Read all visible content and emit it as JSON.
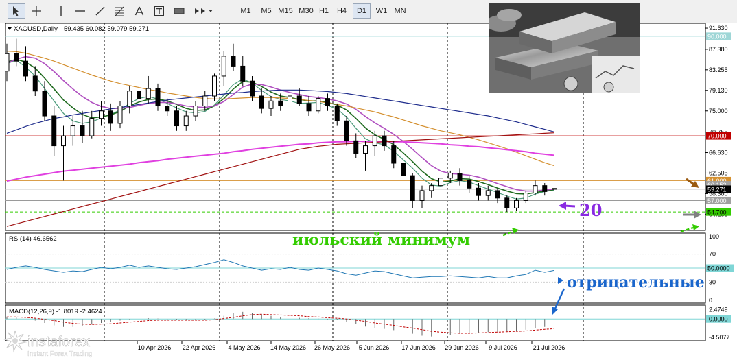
{
  "toolbar": {
    "timeframes": [
      "M1",
      "M5",
      "M15",
      "M30",
      "H1",
      "H4",
      "D1",
      "W1",
      "MN"
    ],
    "active_timeframe": "D1",
    "tools": [
      "cursor-icon",
      "crosshair-icon",
      "vertical-line-icon",
      "horizontal-line-icon",
      "trendline-icon",
      "fibonacci-icon",
      "text-icon",
      "text-label-icon",
      "rectangle-icon",
      "arrows-icon"
    ]
  },
  "main": {
    "symbol_title": "XAGUSD,Daily",
    "ohlc_text": "59.435 60.082 59.079 59.271"
  },
  "colors": {
    "bull": "#ffffff",
    "bear": "#000000",
    "ma_fast": "#4a9a7a",
    "ma_mid": "#1e6a1e",
    "ma_violet": "#b050c0",
    "ma_orange": "#d49030",
    "ma_blue": "#1e2c8c",
    "ma_magenta": "#e040e0",
    "ma_red": "#a01010",
    "rsi": "#1f77b4",
    "macd_signal": "#c00000",
    "annotation_green": "#33cc00",
    "annotation_blue": "#1a66cc",
    "annotation_violet": "#8a2be2",
    "annotation_brown": "#9a5a10",
    "annotation_gray": "#808080"
  },
  "chart_data": [
    {
      "type": "candlestick",
      "symbol": "XAGUSD",
      "timeframe": "Daily",
      "ylim": [
        51.0,
        92.6
      ],
      "y_ticks": [
        "91.630",
        "87.380",
        "83.255",
        "79.130",
        "75.000",
        "70.755",
        "66.630",
        "62.505",
        "58.380",
        "54.255"
      ],
      "x_ticks": [
        "10 Apr 2026",
        "22 Apr 2026",
        "4 May 2026",
        "14 May 2026",
        "26 May 2026",
        "5 Jun 2026",
        "17 Jun 2026",
        "29 Jun 2026",
        "9 Jul 2026",
        "21 Jul 2026"
      ],
      "price_labels": [
        {
          "text": "90.000",
          "value": 90.0
        },
        {
          "text": "70.000",
          "value": 70.0
        },
        {
          "text": "61.000",
          "value": 61.0
        },
        {
          "text": "60.152",
          "value": 60.15
        },
        {
          "text": "59.271",
          "value": 59.271
        },
        {
          "text": "57.000",
          "value": 57.0
        },
        {
          "text": "54.700",
          "value": 54.7
        }
      ],
      "horizontal_levels": [
        90.0,
        70.0,
        61.0,
        57.0,
        54.7
      ],
      "annotations": [
        {
          "text": "июльский минимум"
        },
        {
          "text": "20"
        }
      ],
      "moving_averages": [
        {
          "color": "#4a9a7a",
          "values": [
            84.5,
            85.2,
            83.8,
            82.0,
            79.5,
            77.0,
            74.5,
            73.0,
            72.5,
            72.8,
            73.6,
            74.3,
            75.2,
            76.5,
            77.5,
            77.9,
            77.4,
            76.5,
            75.6,
            74.8,
            74.6,
            74.9,
            76.2,
            78.2,
            80.3,
            81.4,
            80.6,
            79.1,
            77.9,
            77.3,
            77.0,
            76.5,
            76.6,
            76.7,
            76.1,
            75.4,
            73.8,
            71.5,
            69.4,
            68.6,
            68.2,
            66.9,
            65.2,
            63.5,
            61.5,
            60.1,
            59.9,
            60.6,
            61.0,
            60.7,
            60.0,
            59.3,
            58.6,
            57.9,
            57.3,
            57.5,
            58.3,
            58.8,
            59.1
          ]
        },
        {
          "color": "#1e6a1e",
          "values": [
            84.8,
            85.4,
            84.8,
            83.6,
            81.6,
            79.4,
            77.2,
            75.6,
            74.3,
            73.6,
            73.8,
            74.2,
            74.9,
            76.0,
            76.8,
            77.3,
            77.4,
            77.0,
            76.3,
            75.5,
            75.1,
            75.2,
            76.0,
            77.5,
            79.4,
            80.9,
            80.8,
            79.9,
            78.8,
            78.0,
            77.7,
            77.3,
            77.0,
            77.0,
            76.7,
            76.2,
            75.2,
            73.5,
            71.6,
            70.2,
            69.3,
            68.2,
            66.6,
            64.8,
            62.9,
            61.4,
            60.7,
            60.9,
            61.4,
            61.3,
            60.8,
            60.2,
            59.5,
            58.9,
            58.4,
            58.3,
            58.6,
            58.9,
            59.2
          ]
        },
        {
          "color": "#b050c0",
          "values": [
            84.6,
            85.4,
            85.9,
            85.6,
            84.5,
            82.9,
            81.1,
            79.4,
            77.9,
            76.7,
            75.9,
            75.5,
            75.5,
            75.7,
            76.1,
            76.5,
            76.7,
            76.7,
            76.4,
            76.0,
            75.8,
            75.7,
            76.0,
            76.9,
            78.3,
            79.8,
            80.4,
            80.3,
            79.8,
            79.2,
            78.7,
            78.3,
            77.9,
            77.7,
            77.4,
            77.0,
            76.4,
            75.3,
            73.9,
            72.6,
            71.5,
            70.3,
            68.9,
            67.3,
            65.6,
            64.0,
            62.9,
            62.4,
            62.3,
            62.1,
            61.7,
            61.1,
            60.4,
            59.8,
            59.2,
            58.9,
            58.9,
            59.1,
            59.3
          ]
        },
        {
          "color": "#d49030",
          "values": [
            87.0,
            86.9,
            86.6,
            86.1,
            85.6,
            85.0,
            84.3,
            83.6,
            82.9,
            82.2,
            81.6,
            81.0,
            80.5,
            80.1,
            79.7,
            79.3,
            79.0,
            78.6,
            78.3,
            78.0,
            77.7,
            77.5,
            77.4,
            77.4,
            77.5,
            77.6,
            77.7,
            77.7,
            77.7,
            77.6,
            77.5,
            77.3,
            77.1,
            76.9,
            76.6,
            76.3,
            76.0,
            75.6,
            75.2,
            74.8,
            74.3,
            73.8,
            73.2,
            72.6,
            72.0,
            71.5,
            71.0,
            70.6,
            70.2,
            69.7,
            69.2,
            68.6,
            68.0,
            67.4,
            66.7,
            66.0,
            65.3,
            64.6,
            64.0
          ]
        },
        {
          "color": "#1e2c8c",
          "values": [
            70.5,
            71.2,
            71.9,
            72.5,
            73.0,
            73.5,
            73.8,
            74.2,
            74.5,
            74.8,
            75.1,
            75.4,
            75.7,
            76.0,
            76.3,
            76.6,
            76.9,
            77.2,
            77.4,
            77.6,
            77.8,
            78.0,
            78.2,
            78.4,
            78.6,
            78.7,
            78.9,
            79.0,
            79.1,
            79.2,
            79.2,
            79.2,
            79.1,
            79.0,
            78.9,
            78.7,
            78.5,
            78.2,
            77.9,
            77.6,
            77.3,
            77.0,
            76.7,
            76.4,
            76.1,
            75.8,
            75.5,
            75.2,
            74.9,
            74.6,
            74.3,
            74.0,
            73.6,
            73.2,
            72.8,
            72.3,
            71.8,
            71.3,
            70.8
          ]
        },
        {
          "color": "#e040e0",
          "values": [
            60.9,
            61.3,
            61.7,
            62.0,
            62.3,
            62.6,
            62.9,
            63.1,
            63.3,
            63.5,
            63.7,
            63.9,
            64.1,
            64.3,
            64.6,
            64.8,
            65.0,
            65.3,
            65.5,
            65.7,
            65.9,
            66.1,
            66.3,
            66.5,
            66.8,
            67.0,
            67.3,
            67.5,
            67.7,
            67.9,
            68.1,
            68.3,
            68.4,
            68.6,
            68.7,
            68.8,
            68.8,
            68.9,
            68.9,
            68.9,
            68.9,
            68.8,
            68.8,
            68.7,
            68.6,
            68.5,
            68.4,
            68.2,
            68.1,
            67.9,
            67.8,
            67.6,
            67.4,
            67.2,
            67.0,
            66.8,
            66.5,
            66.3,
            66.1
          ]
        },
        {
          "color": "#a01010",
          "values": [
            51.8,
            52.3,
            52.8,
            53.3,
            53.8,
            54.3,
            54.8,
            55.3,
            55.8,
            56.3,
            56.8,
            57.3,
            57.8,
            58.3,
            58.8,
            59.3,
            59.8,
            60.3,
            60.8,
            61.3,
            61.8,
            62.3,
            62.8,
            63.3,
            63.8,
            64.3,
            64.8,
            65.3,
            65.8,
            66.3,
            66.8,
            67.3,
            67.6,
            67.9,
            68.1,
            68.3,
            68.4,
            68.5,
            68.6,
            68.7,
            68.8,
            68.9,
            69.0,
            69.1,
            69.2,
            69.3,
            69.4,
            69.5,
            69.6,
            69.7,
            69.8,
            69.9,
            70.0,
            70.1,
            70.2,
            70.3,
            70.4,
            70.5,
            70.6
          ]
        }
      ],
      "candles": [
        {
          "o": 83.0,
          "h": 88.5,
          "l": 81.0,
          "c": 86.5
        },
        {
          "o": 86.5,
          "h": 89.5,
          "l": 84.0,
          "c": 85.0
        },
        {
          "o": 85.0,
          "h": 88.0,
          "l": 81.0,
          "c": 82.0
        },
        {
          "o": 82.0,
          "h": 84.0,
          "l": 78.0,
          "c": 79.0
        },
        {
          "o": 79.0,
          "h": 81.0,
          "l": 73.0,
          "c": 74.0
        },
        {
          "o": 74.0,
          "h": 76.0,
          "l": 66.0,
          "c": 68.0
        },
        {
          "o": 68.0,
          "h": 72.0,
          "l": 61.0,
          "c": 70.0
        },
        {
          "o": 70.0,
          "h": 74.0,
          "l": 68.0,
          "c": 72.0
        },
        {
          "o": 72.0,
          "h": 75.0,
          "l": 68.5,
          "c": 70.0
        },
        {
          "o": 70.0,
          "h": 75.0,
          "l": 69.5,
          "c": 73.5
        },
        {
          "o": 73.5,
          "h": 77.0,
          "l": 72.0,
          "c": 75.0
        },
        {
          "o": 75.0,
          "h": 76.5,
          "l": 71.0,
          "c": 72.5
        },
        {
          "o": 72.5,
          "h": 77.0,
          "l": 71.5,
          "c": 76.0
        },
        {
          "o": 76.0,
          "h": 80.0,
          "l": 74.5,
          "c": 79.0
        },
        {
          "o": 79.0,
          "h": 81.5,
          "l": 76.5,
          "c": 77.5
        },
        {
          "o": 77.5,
          "h": 82.0,
          "l": 76.5,
          "c": 79.5
        },
        {
          "o": 79.5,
          "h": 80.5,
          "l": 75.0,
          "c": 76.0
        },
        {
          "o": 76.0,
          "h": 77.5,
          "l": 74.0,
          "c": 75.0
        },
        {
          "o": 75.0,
          "h": 76.0,
          "l": 71.0,
          "c": 72.0
        },
        {
          "o": 72.0,
          "h": 75.0,
          "l": 71.0,
          "c": 74.0
        },
        {
          "o": 74.0,
          "h": 77.0,
          "l": 73.0,
          "c": 76.0
        },
        {
          "o": 76.0,
          "h": 79.0,
          "l": 75.0,
          "c": 78.0
        },
        {
          "o": 78.0,
          "h": 82.5,
          "l": 77.0,
          "c": 82.0
        },
        {
          "o": 82.0,
          "h": 87.0,
          "l": 80.0,
          "c": 86.0
        },
        {
          "o": 86.0,
          "h": 88.5,
          "l": 83.0,
          "c": 84.0
        },
        {
          "o": 84.0,
          "h": 86.0,
          "l": 80.0,
          "c": 81.0
        },
        {
          "o": 81.0,
          "h": 82.0,
          "l": 77.0,
          "c": 78.0
        },
        {
          "o": 78.0,
          "h": 79.5,
          "l": 74.5,
          "c": 75.5
        },
        {
          "o": 75.5,
          "h": 78.0,
          "l": 74.0,
          "c": 77.0
        },
        {
          "o": 77.0,
          "h": 78.5,
          "l": 75.0,
          "c": 76.0
        },
        {
          "o": 76.0,
          "h": 79.0,
          "l": 75.5,
          "c": 78.0
        },
        {
          "o": 78.0,
          "h": 79.5,
          "l": 76.0,
          "c": 76.5
        },
        {
          "o": 76.5,
          "h": 78.0,
          "l": 74.0,
          "c": 75.0
        },
        {
          "o": 75.0,
          "h": 78.0,
          "l": 74.5,
          "c": 77.5
        },
        {
          "o": 77.5,
          "h": 78.5,
          "l": 75.0,
          "c": 76.0
        },
        {
          "o": 76.0,
          "h": 76.5,
          "l": 72.0,
          "c": 73.0
        },
        {
          "o": 73.0,
          "h": 74.0,
          "l": 68.0,
          "c": 69.0
        },
        {
          "o": 69.0,
          "h": 70.5,
          "l": 65.5,
          "c": 66.5
        },
        {
          "o": 66.5,
          "h": 69.0,
          "l": 63.0,
          "c": 68.0
        },
        {
          "o": 68.0,
          "h": 71.0,
          "l": 66.0,
          "c": 70.0
        },
        {
          "o": 70.0,
          "h": 71.0,
          "l": 67.0,
          "c": 68.0
        },
        {
          "o": 68.0,
          "h": 69.0,
          "l": 63.5,
          "c": 64.5
        },
        {
          "o": 64.5,
          "h": 65.5,
          "l": 61.0,
          "c": 62.0
        },
        {
          "o": 62.0,
          "h": 62.5,
          "l": 55.5,
          "c": 57.0
        },
        {
          "o": 57.0,
          "h": 60.0,
          "l": 55.5,
          "c": 59.0
        },
        {
          "o": 59.0,
          "h": 60.5,
          "l": 57.5,
          "c": 60.0
        },
        {
          "o": 60.0,
          "h": 62.0,
          "l": 56.0,
          "c": 61.5
        },
        {
          "o": 61.5,
          "h": 63.0,
          "l": 60.5,
          "c": 62.5
        },
        {
          "o": 62.5,
          "h": 63.5,
          "l": 60.0,
          "c": 61.0
        },
        {
          "o": 61.0,
          "h": 62.0,
          "l": 58.5,
          "c": 59.5
        },
        {
          "o": 59.5,
          "h": 60.5,
          "l": 57.0,
          "c": 58.0
        },
        {
          "o": 58.0,
          "h": 60.0,
          "l": 57.0,
          "c": 59.0
        },
        {
          "o": 59.0,
          "h": 59.5,
          "l": 56.5,
          "c": 57.5
        },
        {
          "o": 57.5,
          "h": 58.0,
          "l": 54.7,
          "c": 55.5
        },
        {
          "o": 55.5,
          "h": 57.5,
          "l": 55.0,
          "c": 57.0
        },
        {
          "o": 57.0,
          "h": 59.0,
          "l": 56.5,
          "c": 58.5
        },
        {
          "o": 58.5,
          "h": 61.0,
          "l": 58.0,
          "c": 60.0
        },
        {
          "o": 60.0,
          "h": 60.5,
          "l": 58.0,
          "c": 58.8
        },
        {
          "o": 59.435,
          "h": 60.082,
          "l": 59.079,
          "c": 59.271
        }
      ]
    },
    {
      "type": "line",
      "title": "RSI(14) 46.6562",
      "ylim": [
        0,
        100
      ],
      "y_ticks": [
        "100",
        "70",
        "30",
        "0"
      ],
      "level_label": "50.0000",
      "level": 50,
      "annotation": "отрицательные",
      "values": [
        48,
        51,
        53,
        51,
        48,
        46,
        44,
        46,
        45,
        48,
        51,
        49,
        51,
        54,
        51,
        53,
        51,
        49,
        48,
        50,
        52,
        55,
        58,
        62,
        58,
        53,
        50,
        47,
        49,
        48,
        51,
        48,
        47,
        50,
        48,
        46,
        42,
        40,
        43,
        46,
        45,
        42,
        39,
        36,
        37,
        38,
        38,
        39,
        38,
        37,
        36,
        38,
        36,
        36,
        39,
        41,
        47,
        44,
        46.6562
      ]
    },
    {
      "type": "bar",
      "title": "MACD(12,26,9) -1.8019 -2.4624",
      "y_ticks": [
        "2.4749",
        "0.0000",
        "-4.5077"
      ],
      "ylim": [
        -5.5,
        3.5
      ],
      "histogram": [
        0.6,
        0.4,
        0.0,
        -0.4,
        -1.0,
        -1.6,
        -2.0,
        -2.0,
        -1.8,
        -1.4,
        -1.0,
        -0.7,
        -0.4,
        -0.1,
        0.1,
        0.2,
        0.1,
        -0.1,
        -0.3,
        -0.4,
        -0.4,
        -0.3,
        0.1,
        0.8,
        1.5,
        1.8,
        1.6,
        1.2,
        0.8,
        0.5,
        0.4,
        0.3,
        0.2,
        0.1,
        -0.1,
        -0.3,
        -0.7,
        -1.3,
        -1.9,
        -2.3,
        -2.5,
        -2.8,
        -3.2,
        -3.7,
        -4.2,
        -4.4,
        -4.3,
        -4.0,
        -3.7,
        -3.5,
        -3.4,
        -3.3,
        -3.2,
        -3.1,
        -3.0,
        -2.7,
        -2.3,
        -2.0,
        -1.8019
      ],
      "signal": [
        0.5,
        0.5,
        0.4,
        0.2,
        -0.1,
        -0.4,
        -0.8,
        -1.1,
        -1.3,
        -1.4,
        -1.3,
        -1.2,
        -1.0,
        -0.8,
        -0.6,
        -0.4,
        -0.3,
        -0.3,
        -0.3,
        -0.3,
        -0.3,
        -0.3,
        -0.2,
        0.1,
        0.4,
        0.8,
        1.1,
        1.2,
        1.1,
        1.0,
        0.9,
        0.8,
        0.6,
        0.5,
        0.3,
        0.2,
        0.0,
        -0.3,
        -0.6,
        -1.0,
        -1.3,
        -1.6,
        -2.0,
        -2.3,
        -2.7,
        -3.1,
        -3.3,
        -3.5,
        -3.6,
        -3.6,
        -3.5,
        -3.4,
        -3.3,
        -3.2,
        -3.1,
        -3.0,
        -2.8,
        -2.6,
        -2.4624
      ]
    }
  ],
  "annotations": {
    "july_low": "июльский минимум",
    "ma_number": "20",
    "negative": "отрицательные"
  },
  "logo": {
    "brand": "instaforex",
    "tagline": "Instant Forex Trading"
  }
}
